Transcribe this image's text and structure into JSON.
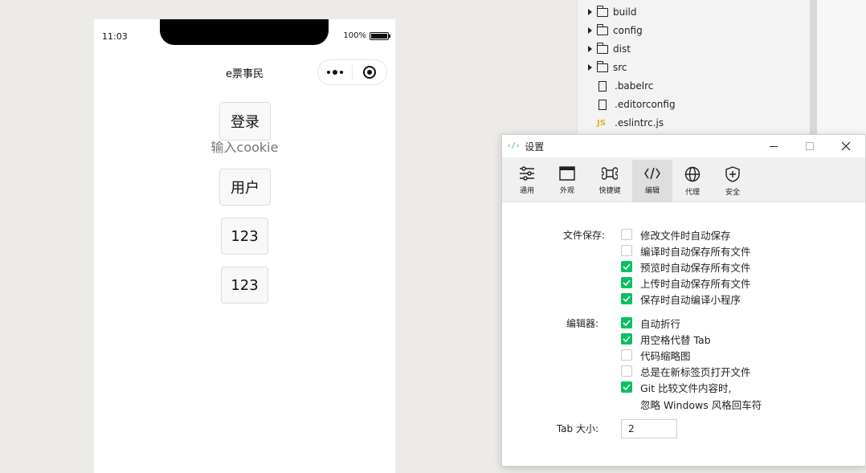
{
  "phone": {
    "status_time": "11:03",
    "battery_text": "100%",
    "battery_level": 1.0,
    "nav_title": "e票事民",
    "buttons": {
      "login": "登录",
      "user": "用户",
      "num1": "123",
      "num2": "123"
    },
    "cookie_placeholder": "输入cookie"
  },
  "explorer": {
    "items": [
      {
        "type": "folder",
        "name": "build",
        "icon": "folder-icon"
      },
      {
        "type": "folder",
        "name": "config",
        "icon": "folder-icon"
      },
      {
        "type": "folder",
        "name": "dist",
        "icon": "folder-icon"
      },
      {
        "type": "folder",
        "name": "src",
        "icon": "folder-icon"
      },
      {
        "type": "file",
        "name": ".babelrc",
        "icon": "file-icon"
      },
      {
        "type": "file",
        "name": ".editorconfig",
        "icon": "file-icon"
      },
      {
        "type": "js",
        "name": ".eslintrc.js",
        "icon": "js-icon",
        "badge": "JS"
      }
    ]
  },
  "dialog": {
    "app_icon": "‹/›",
    "title": "设置",
    "tabs": [
      {
        "label": "通用",
        "icon": "sliders-icon"
      },
      {
        "label": "外观",
        "icon": "window-icon"
      },
      {
        "label": "快捷键",
        "icon": "command-icon"
      },
      {
        "label": "编辑",
        "icon": "code-icon",
        "active": true
      },
      {
        "label": "代理",
        "icon": "globe-icon"
      },
      {
        "label": "安全",
        "icon": "shield-plus-icon"
      }
    ],
    "file_save": {
      "label": "文件保存:",
      "options": [
        {
          "text": "修改文件时自动保存",
          "checked": false
        },
        {
          "text": "编译时自动保存所有文件",
          "checked": false
        },
        {
          "text": "预览时自动保存所有文件",
          "checked": true
        },
        {
          "text": "上传时自动保存所有文件",
          "checked": true
        },
        {
          "text": "保存时自动编译小程序",
          "checked": true
        }
      ]
    },
    "editor": {
      "label": "编辑器:",
      "options": [
        {
          "text": "自动折行",
          "checked": true
        },
        {
          "text": "用空格代替 Tab",
          "checked": true
        },
        {
          "text": "代码缩略图",
          "checked": false
        },
        {
          "text": "总是在新标签页打开文件",
          "checked": false
        },
        {
          "text": "Git 比较文件内容时,",
          "checked": true
        }
      ],
      "git_sub": "忽略 Windows 风格回车符"
    },
    "tab_size": {
      "label": "Tab 大小:",
      "value": "2"
    }
  },
  "colors": {
    "accent_green": "#07c160",
    "js_yellow": "#e0b020"
  }
}
